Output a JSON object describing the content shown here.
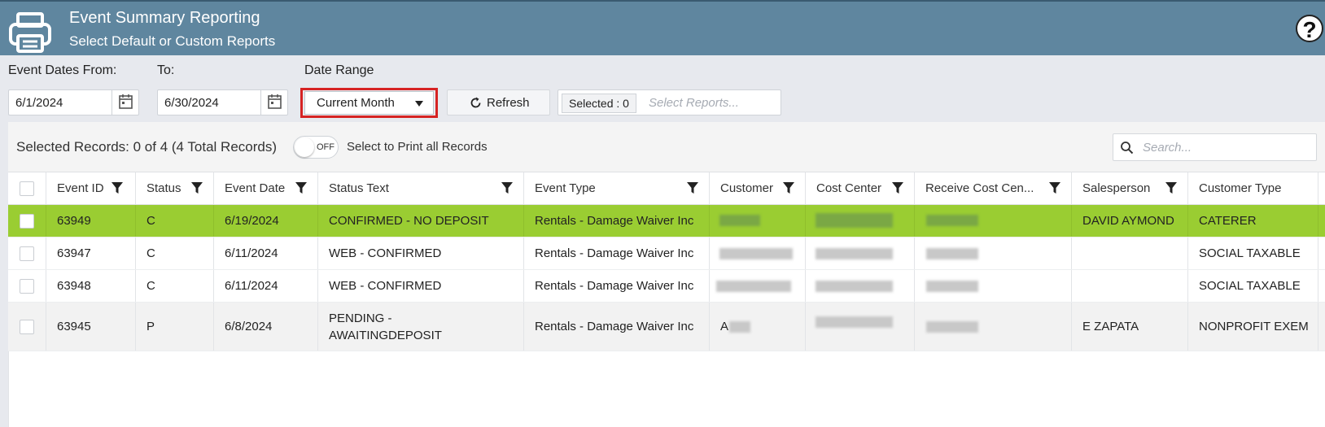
{
  "header": {
    "title": "Event Summary Reporting",
    "subtitle": "Select Default or Custom Reports",
    "logo_icon": "printer-icon",
    "help_icon": "help-icon",
    "help_text": "?"
  },
  "filters": {
    "from_label": "Event Dates From:",
    "from_value": "6/1/2024",
    "to_label": "To:",
    "to_value": "6/30/2024",
    "date_range_label": "Date Range",
    "date_range_value": "Current Month",
    "refresh_label": "Refresh",
    "selected_badge": "Selected : 0",
    "reports_placeholder": "Select Reports..."
  },
  "toolbar": {
    "selected_records": "Selected Records: 0 of 4 (4 Total Records)",
    "toggle_state": "OFF",
    "print_all_label": "Select to Print all Records",
    "search_placeholder": "Search..."
  },
  "columns": [
    "Event ID",
    "Status",
    "Event Date",
    "Status Text",
    "Event Type",
    "Customer",
    "Cost Center",
    "Receive Cost Cen...",
    "Salesperson",
    "Customer Type"
  ],
  "rows": [
    {
      "event_id": "63949",
      "status": "C",
      "event_date": "6/19/2024",
      "status_text": "CONFIRMED - NO DEPOSIT",
      "event_type": "Rentals - Damage Waiver Inc",
      "customer": "",
      "cost_center": "",
      "receive_cost_center": "",
      "salesperson": "DAVID AYMOND",
      "customer_type": "CATERER",
      "highlighted": true
    },
    {
      "event_id": "63947",
      "status": "C",
      "event_date": "6/11/2024",
      "status_text": "WEB - CONFIRMED",
      "event_type": "Rentals - Damage Waiver Inc",
      "customer": "",
      "cost_center": "",
      "receive_cost_center": "",
      "salesperson": "",
      "customer_type": "SOCIAL TAXABLE",
      "highlighted": false
    },
    {
      "event_id": "63948",
      "status": "C",
      "event_date": "6/11/2024",
      "status_text": "WEB - CONFIRMED",
      "event_type": "Rentals - Damage Waiver Inc",
      "customer": "",
      "cost_center": "",
      "receive_cost_center": "",
      "salesperson": "",
      "customer_type": "SOCIAL TAXABLE",
      "highlighted": false
    },
    {
      "event_id": "63945",
      "status": "P",
      "event_date": "6/8/2024",
      "status_text_line1": "PENDING -",
      "status_text_line2": "AWAITINGDEPOSIT",
      "event_type": "Rentals - Damage Waiver Inc",
      "customer": "A",
      "cost_center": "",
      "receive_cost_center": "",
      "salesperson": "E ZAPATA",
      "customer_type": "NONPROFIT EXEM",
      "highlighted": false
    }
  ],
  "colors": {
    "header_bg": "#5f869f",
    "highlight_row": "#9acd32",
    "alt_row": "#f2f2f2",
    "date_range_outline": "#d62323"
  }
}
